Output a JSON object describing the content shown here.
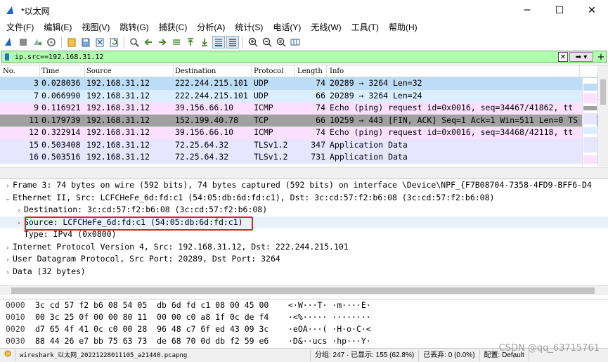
{
  "window": {
    "title": "*以太网",
    "controls": [
      "─",
      "☐",
      "✕"
    ]
  },
  "menu": [
    "文件(F)",
    "编辑(E)",
    "视图(V)",
    "跳转(G)",
    "捕获(C)",
    "分析(A)",
    "统计(S)",
    "电话(Y)",
    "无线(W)",
    "工具(T)",
    "帮助(H)"
  ],
  "toolbar_icons": [
    "shark-fin-start-icon",
    "stop-icon",
    "restart-icon",
    "options-icon",
    "open-file-icon",
    "save-file-icon",
    "close-file-icon",
    "reload-icon",
    "find-icon",
    "back-icon",
    "forward-icon",
    "go-to-packet-icon",
    "first-packet-icon",
    "last-packet-icon",
    "autoscroll-icon",
    "colorize-icon",
    "zoom-in-icon",
    "zoom-out-icon",
    "zoom-reset-icon",
    "resize-columns-icon"
  ],
  "filter": {
    "value": "ip.src==192.168.31.12"
  },
  "packet_list": {
    "headers": [
      "No.",
      "Time",
      "Source",
      "Destination",
      "Protocol",
      "Length",
      "Info"
    ],
    "rows": [
      {
        "no": "3",
        "time": "0.028036",
        "src": "192.168.31.12",
        "dst": "222.244.215.101",
        "proto": "UDP",
        "len": "74",
        "info": "20289 → 3264 Len=32",
        "style": "row-udp-sel"
      },
      {
        "no": "7",
        "time": "0.066990",
        "src": "192.168.31.12",
        "dst": "222.244.215.101",
        "proto": "UDP",
        "len": "66",
        "info": "20289 → 3264 Len=24",
        "style": "row-udp"
      },
      {
        "no": "9",
        "time": "0.116921",
        "src": "192.168.31.12",
        "dst": "39.156.66.10",
        "proto": "ICMP",
        "len": "74",
        "info": "Echo (ping) request  id=0x0016, seq=34467/41862, tt",
        "style": "row-icmp"
      },
      {
        "no": "11",
        "time": "0.179739",
        "src": "192.168.31.12",
        "dst": "152.199.40.78",
        "proto": "TCP",
        "len": "66",
        "info": "10259 → 443 [FIN, ACK] Seq=1 Ack=1 Win=511 Len=0 TS",
        "style": "row-tcp-fin"
      },
      {
        "no": "12",
        "time": "0.322914",
        "src": "192.168.31.12",
        "dst": "39.156.66.10",
        "proto": "ICMP",
        "len": "74",
        "info": "Echo (ping) request  id=0x0016, seq=34468/42118, tt",
        "style": "row-icmp"
      },
      {
        "no": "15",
        "time": "0.503408",
        "src": "192.168.31.12",
        "dst": "72.25.64.32",
        "proto": "TLSv1.2",
        "len": "347",
        "info": "Application Data",
        "style": "row-tls"
      },
      {
        "no": "16",
        "time": "0.503516",
        "src": "192.168.31.12",
        "dst": "72.25.64.32",
        "proto": "TLSv1.2",
        "len": "731",
        "info": "Application Data",
        "style": "row-tls"
      }
    ]
  },
  "details": [
    {
      "text": "Frame 3: 74 bytes on wire (592 bits), 74 bytes captured (592 bits) on interface \\Device\\NPF_{F7B08704-7358-4FD9-BFF6-D4",
      "arrow": "›",
      "indent": 0
    },
    {
      "text": "Ethernet II, Src: LCFCHeFe_6d:fd:c1 (54:05:db:6d:fd:c1), Dst: 3c:cd:57:f2:b6:08 (3c:cd:57:f2:b6:08)",
      "arrow": "⌄",
      "indent": 0
    },
    {
      "text": "Destination: 3c:cd:57:f2:b6:08 (3c:cd:57:f2:b6:08)",
      "arrow": "›",
      "indent": 1
    },
    {
      "text": "Source: LCFCHeFe_6d:fd:c1 (54:05:db:6d:fd:c1)",
      "arrow": "›",
      "indent": 1,
      "highlight": true
    },
    {
      "text": "Type: IPv4 (0x0800)",
      "arrow": "",
      "indent": 1
    },
    {
      "text": "Internet Protocol Version 4, Src: 192.168.31.12, Dst: 222.244.215.101",
      "arrow": "›",
      "indent": 0
    },
    {
      "text": "User Datagram Protocol, Src Port: 20289, Dst Port: 3264",
      "arrow": "›",
      "indent": 0
    },
    {
      "text": "Data (32 bytes)",
      "arrow": "›",
      "indent": 0
    }
  ],
  "bytes": [
    {
      "offset": "0000",
      "hex": "3c cd 57 f2 b6 08 54 05  db 6d fd c1 08 00 45 00",
      "ascii": "<·W···T· ·m····E·"
    },
    {
      "offset": "0010",
      "hex": "00 3c 25 0f 00 00 80 11  00 00 c0 a8 1f 0c de f4",
      "ascii": "·<%····· ········"
    },
    {
      "offset": "0020",
      "hex": "d7 65 4f 41 0c c0 00 28  96 48 c7 6f ed 43 09 3c",
      "ascii": "·eOA···( ·H·o·C·<"
    },
    {
      "offset": "0030",
      "hex": "88 44 26 e7 bb 75 63 73  de 68 70 0d db f2 59 e6",
      "ascii": "·D&··ucs ·hp···Y·"
    }
  ],
  "status": {
    "file": "wireshark_以太网_20221228011105_a21440.pcapng",
    "packets": "分组: 247 · 已显示: 155 (62.8%)",
    "dropped": "已丢弃: 0 (0.0%)",
    "profile": "配置: Default"
  },
  "watermark": "CSDN @qq_63715761",
  "colors": {
    "filter_bg": "#afffaf",
    "udp": "#daeeff",
    "icmp": "#fce0ff",
    "tcp_fin": "#a0a0a0",
    "tls": "#e7e6ff",
    "annotation": "#e02020"
  }
}
